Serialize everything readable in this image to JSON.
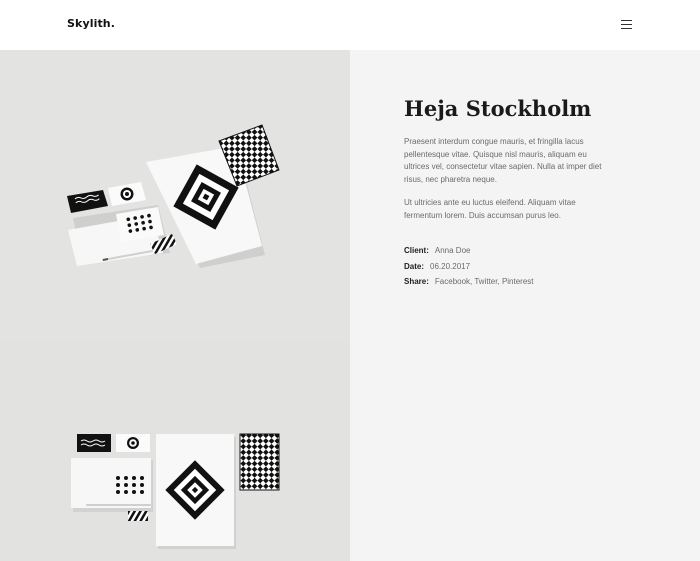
{
  "header": {
    "logo": "Skylith.",
    "menu_icon": "hamburger-menu-icon"
  },
  "project": {
    "title": "Heja Stockholm",
    "paragraphs": [
      "Praesent interdum congue mauris, et fringilla lacus pellentesque vitae. Quisque nisl mauris, aliquam eu ultrices vel, consectetur vitae sapien. Nulla at imper diet risus, nec pharetra neque.",
      "Ut ultricies ante eu luctus eleifend. Aliquam vitae fermentum lorem. Duis accumsan purus leo."
    ],
    "meta": {
      "client_label": "Client:",
      "client": "Anna Doe",
      "date_label": "Date:",
      "date": "06.20.2017",
      "share_label": "Share:",
      "share_links": [
        "Facebook",
        "Twitter",
        "Pinterest"
      ],
      "share_separator": ", "
    }
  },
  "gallery": {
    "images": [
      "stationery-mockup-angled",
      "stationery-mockup-flat"
    ]
  },
  "colors": {
    "content_bg": "#f4f4f4",
    "gallery_bg": "#e3e4e2",
    "text_dark": "#1a1a1a",
    "text_muted": "#6b6b6b"
  }
}
